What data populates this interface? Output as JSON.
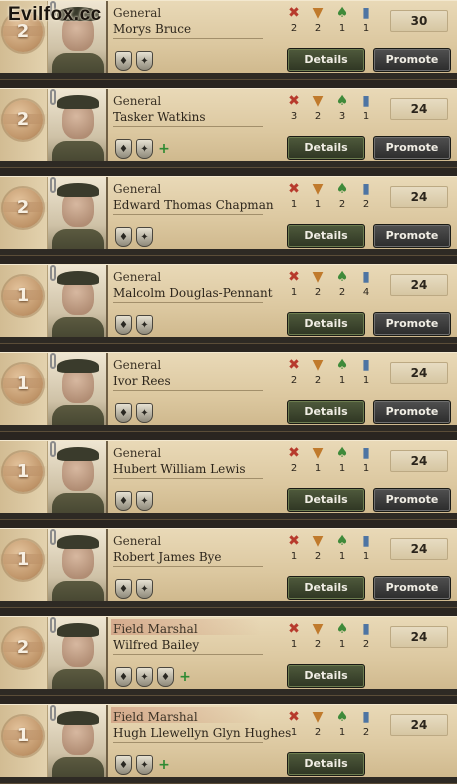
{
  "watermark": "Evilfox.cc",
  "stat_icons": {
    "attack": "crossed-swords-icon",
    "defense": "shield-icon",
    "planning": "planning-icon",
    "logistics": "logistics-icon"
  },
  "buttons": {
    "details_label": "Details",
    "promote_label": "Promote"
  },
  "colors": {
    "card_parchment": "#dcc8a0",
    "details_button": "#3f4a2f",
    "promote_button": "#3c3c3c",
    "attack_red": "#b73a2c",
    "defense_orange": "#c07a2c",
    "planning_green": "#3f8a3a",
    "logistics_blue": "#4d74a3"
  },
  "generals": [
    {
      "rank_number": "2",
      "rank": "General",
      "name": "Morys Bruce",
      "stats": {
        "attack": "2",
        "defense": "2",
        "planning": "1",
        "logistics": "1"
      },
      "skill": "30",
      "traits": [
        "t1",
        "t2"
      ],
      "can_promote": true,
      "field_marshal": false
    },
    {
      "rank_number": "2",
      "rank": "General",
      "name": "Tasker Watkins",
      "stats": {
        "attack": "3",
        "defense": "2",
        "planning": "3",
        "logistics": "1"
      },
      "skill": "24",
      "traits": [
        "t1",
        "t2",
        "add"
      ],
      "can_promote": true,
      "field_marshal": false
    },
    {
      "rank_number": "2",
      "rank": "General",
      "name": "Edward Thomas Chapman",
      "stats": {
        "attack": "1",
        "defense": "1",
        "planning": "2",
        "logistics": "2"
      },
      "skill": "24",
      "traits": [
        "t1",
        "t2"
      ],
      "can_promote": true,
      "field_marshal": false
    },
    {
      "rank_number": "1",
      "rank": "General",
      "name": "Malcolm Douglas-Pennant",
      "stats": {
        "attack": "1",
        "defense": "2",
        "planning": "2",
        "logistics": "4"
      },
      "skill": "24",
      "traits": [
        "t1",
        "t2"
      ],
      "can_promote": true,
      "field_marshal": false
    },
    {
      "rank_number": "1",
      "rank": "General",
      "name": "Ivor Rees",
      "stats": {
        "attack": "2",
        "defense": "2",
        "planning": "1",
        "logistics": "1"
      },
      "skill": "24",
      "traits": [
        "t1",
        "t2"
      ],
      "can_promote": true,
      "field_marshal": false
    },
    {
      "rank_number": "1",
      "rank": "General",
      "name": "Hubert William Lewis",
      "stats": {
        "attack": "2",
        "defense": "1",
        "planning": "1",
        "logistics": "1"
      },
      "skill": "24",
      "traits": [
        "t1",
        "t2"
      ],
      "can_promote": true,
      "field_marshal": false
    },
    {
      "rank_number": "1",
      "rank": "General",
      "name": "Robert James Bye",
      "stats": {
        "attack": "1",
        "defense": "2",
        "planning": "1",
        "logistics": "1"
      },
      "skill": "24",
      "traits": [
        "t1",
        "t2"
      ],
      "can_promote": true,
      "field_marshal": false
    },
    {
      "rank_number": "2",
      "rank": "Field Marshal",
      "name": "Wilfred Bailey",
      "stats": {
        "attack": "1",
        "defense": "2",
        "planning": "1",
        "logistics": "2"
      },
      "skill": "24",
      "traits": [
        "t1",
        "t2",
        "t3",
        "add"
      ],
      "can_promote": false,
      "field_marshal": true
    },
    {
      "rank_number": "1",
      "rank": "Field Marshal",
      "name": "Hugh Llewellyn Glyn Hughes",
      "stats": {
        "attack": "1",
        "defense": "2",
        "planning": "1",
        "logistics": "2"
      },
      "skill": "24",
      "traits": [
        "t1",
        "t2",
        "add"
      ],
      "can_promote": false,
      "field_marshal": true
    }
  ]
}
